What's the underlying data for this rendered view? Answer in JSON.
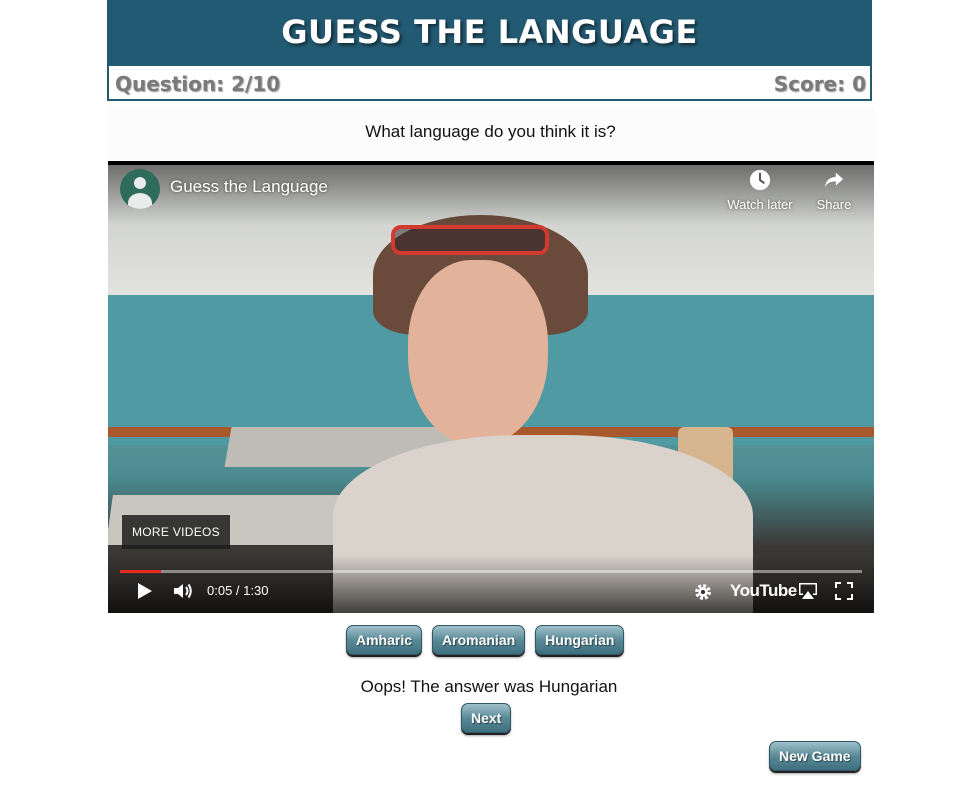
{
  "header": {
    "title": "GUESS THE LANGUAGE"
  },
  "scorebar": {
    "question": "Question: 2/10",
    "score": "Score: 0"
  },
  "prompt": "What language do you think it is?",
  "video": {
    "channel_title": "Guess the Language",
    "watch_later": "Watch later",
    "share": "Share",
    "more_videos": "MORE VIDEOS",
    "time": "0:05 / 1:30",
    "progress_percent": 5.5,
    "logo": "YouTube",
    "icons": [
      "user-avatar-icon",
      "clock-icon",
      "share-arrow-icon",
      "play-icon",
      "volume-icon",
      "gear-icon",
      "airplay-icon",
      "fullscreen-icon"
    ],
    "progress_color": "#e52a22"
  },
  "answers": [
    "Amharic",
    "Aromanian",
    "Hungarian"
  ],
  "result": "Oops! The answer was Hungarian",
  "buttons": {
    "next": "Next",
    "new_game": "New Game"
  },
  "colors": {
    "header_bg": "#235a73",
    "button_mid": "#5a8a98"
  }
}
